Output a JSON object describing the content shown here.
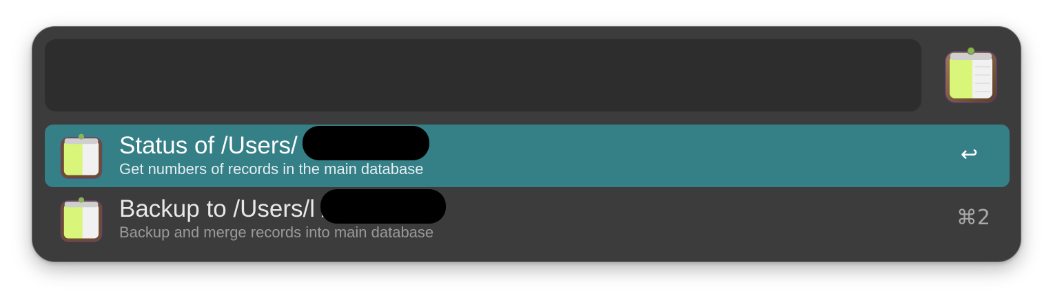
{
  "search": {
    "value": "",
    "placeholder": ""
  },
  "app_icon": {
    "icon": "clipboard-notepad-icon"
  },
  "results": [
    {
      "title": "Status of /Users/          e/Clipboard",
      "subtitle": "Get numbers of records in the main database",
      "shortcut": "↩",
      "selected": true,
      "icon": "clipboard-notepad-icon"
    },
    {
      "title": "Backup to /Users/l                /Clipboard",
      "subtitle": "Backup and merge records into main database",
      "shortcut": "⌘2",
      "selected": false,
      "icon": "clipboard-notepad-icon"
    }
  ],
  "colors": {
    "window_bg": "#3c3c3c",
    "search_bg": "#2d2d2d",
    "selection": "#357f87",
    "icon_green": "#d9f57a",
    "icon_frame": "#7a5a3c"
  }
}
